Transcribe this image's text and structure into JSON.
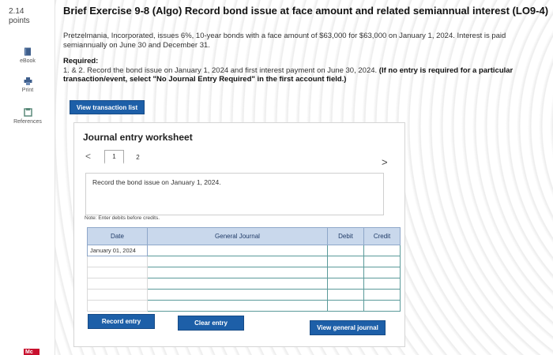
{
  "rail": {
    "points_value": "2.14",
    "points_label": "points",
    "tools": [
      {
        "label": "eBook",
        "icon": "book-icon"
      },
      {
        "label": "Print",
        "icon": "print-icon"
      },
      {
        "label": "References",
        "icon": "references-icon"
      }
    ],
    "logo": "Mc"
  },
  "exercise": {
    "title": "Brief Exercise 9-8 (Algo) Record bond issue at face amount and related semiannual interest (LO9-4)",
    "problem": "Pretzelmania, Incorporated, issues 6%, 10-year bonds with a face amount of $63,000 for $63,000 on January 1, 2024. Interest is paid semiannually on June 30 and December 31.",
    "required_label": "Required:",
    "required_text": "1. & 2. Record the bond issue on January 1, 2024 and first interest payment on June 30, 2024.",
    "required_bold": "(If no entry is required for a particular transaction/event, select \"No Journal Entry Required\" in the first account field.)"
  },
  "buttons": {
    "view_transaction_list": "View transaction list",
    "record_entry": "Record entry",
    "clear_entry": "Clear entry",
    "view_general_journal": "View general journal"
  },
  "worksheet": {
    "title": "Journal entry worksheet",
    "nav_prev": "<",
    "nav_next": ">",
    "tabs": [
      "1",
      "2"
    ],
    "instruction": "Record the bond issue on January 1, 2024.",
    "note": "Note: Enter debits before credits.",
    "columns": {
      "date": "Date",
      "account": "General Journal",
      "debit": "Debit",
      "credit": "Credit"
    },
    "rows": [
      {
        "date": "January 01, 2024",
        "account": "",
        "debit": "",
        "credit": ""
      },
      {
        "date": "",
        "account": "",
        "debit": "",
        "credit": ""
      },
      {
        "date": "",
        "account": "",
        "debit": "",
        "credit": ""
      },
      {
        "date": "",
        "account": "",
        "debit": "",
        "credit": ""
      },
      {
        "date": "",
        "account": "",
        "debit": "",
        "credit": ""
      },
      {
        "date": "",
        "account": "",
        "debit": "",
        "credit": ""
      }
    ]
  },
  "colors": {
    "primary_button": "#1d5fa8",
    "table_header": "#c9d8ec",
    "input_border": "#5a9a9a"
  }
}
